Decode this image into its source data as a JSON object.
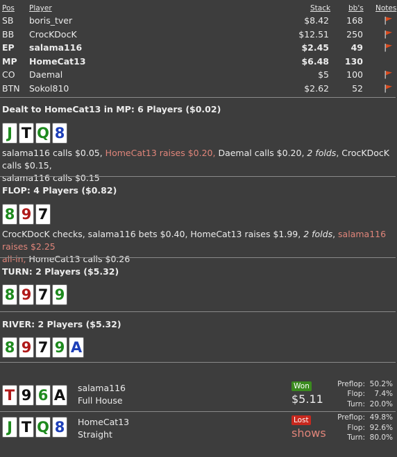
{
  "header": {
    "pos": "Pos",
    "player": "Player",
    "stack": "Stack",
    "bbs": "bb's",
    "notes": "Notes"
  },
  "players": [
    {
      "pos": "SB",
      "name": "boris_tver",
      "stack": "$8.42",
      "bb": "168",
      "has_flag": true,
      "bold": false
    },
    {
      "pos": "BB",
      "name": "CrocKDocK",
      "stack": "$12.51",
      "bb": "250",
      "has_flag": true,
      "bold": false
    },
    {
      "pos": "EP",
      "name": "salama116",
      "stack": "$2.45",
      "bb": "49",
      "has_flag": true,
      "bold": true
    },
    {
      "pos": "MP",
      "name": "HomeCat13",
      "stack": "$6.48",
      "bb": "130",
      "has_flag": false,
      "bold": true
    },
    {
      "pos": "CO",
      "name": "Daemal",
      "stack": "$5",
      "bb": "100",
      "has_flag": true,
      "bold": false
    },
    {
      "pos": "BTN",
      "name": "Sokol810",
      "stack": "$2.62",
      "bb": "52",
      "has_flag": true,
      "bold": false
    }
  ],
  "preflop": {
    "title": "Dealt to HomeCat13 in MP: 6 Players ($0.02)",
    "cards": [
      {
        "rank": "J",
        "suit": "c"
      },
      {
        "rank": "T",
        "suit": "s"
      },
      {
        "rank": "Q",
        "suit": "c"
      },
      {
        "rank": "8",
        "suit": "d"
      }
    ],
    "a1": "salama116 calls $0.05, ",
    "a2": "HomeCat13 raises $0.20,",
    "a3": " Daemal calls $0.20, ",
    "a4": "2 folds",
    "a5": ", CrocKDocK calls $0.15,",
    "a6": "salama116 calls $0.15"
  },
  "flop": {
    "title": "FLOP: 4 Players ($0.82)",
    "cards": [
      {
        "rank": "8",
        "suit": "c"
      },
      {
        "rank": "9",
        "suit": "h"
      },
      {
        "rank": "7",
        "suit": "s"
      }
    ],
    "a1": "CrocKDocK checks, salama116 bets $0.40, HomeCat13 raises $1.99, ",
    "a2": "2 folds",
    "a3": ", ",
    "a4": "salama116 raises $2.25",
    "a5": "all-in,",
    "a6": " HomeCat13 calls $0.26"
  },
  "turn": {
    "title": "TURN: 2 Players ($5.32)",
    "cards": [
      {
        "rank": "8",
        "suit": "c"
      },
      {
        "rank": "9",
        "suit": "h"
      },
      {
        "rank": "7",
        "suit": "s"
      },
      {
        "rank": "9",
        "suit": "c"
      }
    ]
  },
  "river": {
    "title": "RIVER: 2 Players ($5.32)",
    "cards": [
      {
        "rank": "8",
        "suit": "c"
      },
      {
        "rank": "9",
        "suit": "h"
      },
      {
        "rank": "7",
        "suit": "s"
      },
      {
        "rank": "9",
        "suit": "c"
      },
      {
        "rank": "A",
        "suit": "d"
      }
    ]
  },
  "showdown": [
    {
      "name": "salama116",
      "hand": "Full House",
      "cards": [
        {
          "rank": "T",
          "suit": "h"
        },
        {
          "rank": "9",
          "suit": "s"
        },
        {
          "rank": "6",
          "suit": "c"
        },
        {
          "rank": "A",
          "suit": "s"
        }
      ],
      "result": "Won",
      "amount": "$5.11",
      "stats": {
        "preflop_label": "Preflop:",
        "preflop": "50.2%",
        "flop_label": "Flop:",
        "flop": "7.4%",
        "turn_label": "Turn:",
        "turn": "20.0%"
      }
    },
    {
      "name": "HomeCat13",
      "hand": "Straight",
      "cards": [
        {
          "rank": "J",
          "suit": "c"
        },
        {
          "rank": "T",
          "suit": "s"
        },
        {
          "rank": "Q",
          "suit": "c"
        },
        {
          "rank": "8",
          "suit": "d"
        }
      ],
      "result": "Lost",
      "amount": "shows",
      "stats": {
        "preflop_label": "Preflop:",
        "preflop": "49.8%",
        "flop_label": "Flop:",
        "flop": "92.6%",
        "turn_label": "Turn:",
        "turn": "80.0%"
      }
    }
  ],
  "colors": {
    "background": "#3d3d3d",
    "raise_text": "#e0857a",
    "won_badge": "#3a8a1e",
    "lost_badge": "#c8281e",
    "flag": "#d84b1f"
  },
  "icons": {
    "note_flag": "flag-icon"
  }
}
